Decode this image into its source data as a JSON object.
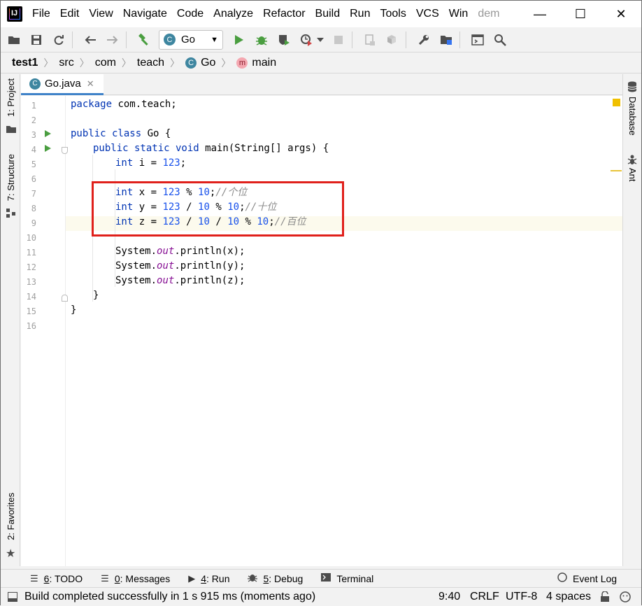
{
  "menubar": {
    "items": [
      "File",
      "Edit",
      "View",
      "Navigate",
      "Code",
      "Analyze",
      "Refactor",
      "Build",
      "Run",
      "Tools",
      "VCS",
      "Win",
      "dem"
    ],
    "minimize": "—",
    "maximize": "☐",
    "close": "✕"
  },
  "toolbar": {
    "run_config": "Go"
  },
  "breadcrumb": {
    "project": "test1",
    "items": [
      "src",
      "com",
      "teach",
      "Go",
      "main"
    ]
  },
  "left_tools": {
    "project": "1: Project",
    "structure": "7: Structure",
    "favorites": "2: Favorites"
  },
  "right_tools": {
    "database": "Database",
    "ant": "Ant"
  },
  "tab": {
    "label": "Go.java",
    "close": "✕"
  },
  "editor": {
    "line_numbers": [
      "1",
      "2",
      "3",
      "4",
      "5",
      "6",
      "7",
      "8",
      "9",
      "10",
      "11",
      "12",
      "13",
      "14",
      "15",
      "16"
    ],
    "caret_line": 9,
    "lines": {
      "l1_kw": "package",
      "l1_rest": " com.teach;",
      "l3_kw": "public class",
      "l3_rest": " Go {",
      "l4_kw": "public static void",
      "l4_rest": " main(String[] args) {",
      "l5_kw": "int",
      "l5_a": " i = ",
      "l5_num": "123",
      "l5_end": ";",
      "l7_kw": "int",
      "l7_a": " x = ",
      "l7_n1": "123",
      "l7_b": " % ",
      "l7_n2": "10",
      "l7_c": ";",
      "l7_cm": "//个位",
      "l8_kw": "int",
      "l8_a": " y = ",
      "l8_n1": "123",
      "l8_b": " / ",
      "l8_n2": "10",
      "l8_c": " % ",
      "l8_n3": "10",
      "l8_d": ";",
      "l8_cm": "//十位",
      "l9_kw": "int",
      "l9_a": " z = ",
      "l9_n1": "123",
      "l9_b": " / ",
      "l9_n2": "10",
      "l9_c": " / ",
      "l9_n3": "10",
      "l9_d": " % ",
      "l9_n4": "10",
      "l9_e": ";",
      "l9_cm": "//百位",
      "println_a": "System.",
      "println_out": "out",
      "l11_b": ".println(x);",
      "l12_b": ".println(y);",
      "l13_b": ".println(z);",
      "l14": "}",
      "l15": "}"
    }
  },
  "bottom_tools": {
    "todo_num": "6",
    "todo": ": TODO",
    "messages_num": "0",
    "messages": ": Messages",
    "run_num": "4",
    "run": ": Run",
    "debug_num": "5",
    "debug": ": Debug",
    "terminal": "Terminal",
    "event_log": "Event Log"
  },
  "status": {
    "message": "Build completed successfully in 1 s 915 ms (moments ago)",
    "position": "9:40",
    "line_sep": "CRLF",
    "encoding": "UTF-8",
    "indent": "4 spaces"
  },
  "colors": {
    "keyword": "#0033b3",
    "number": "#1750eb",
    "static_field": "#871094",
    "comment": "#8c8c8c",
    "highlight_box": "#e0201b",
    "run_marker": "#4a9e40"
  }
}
